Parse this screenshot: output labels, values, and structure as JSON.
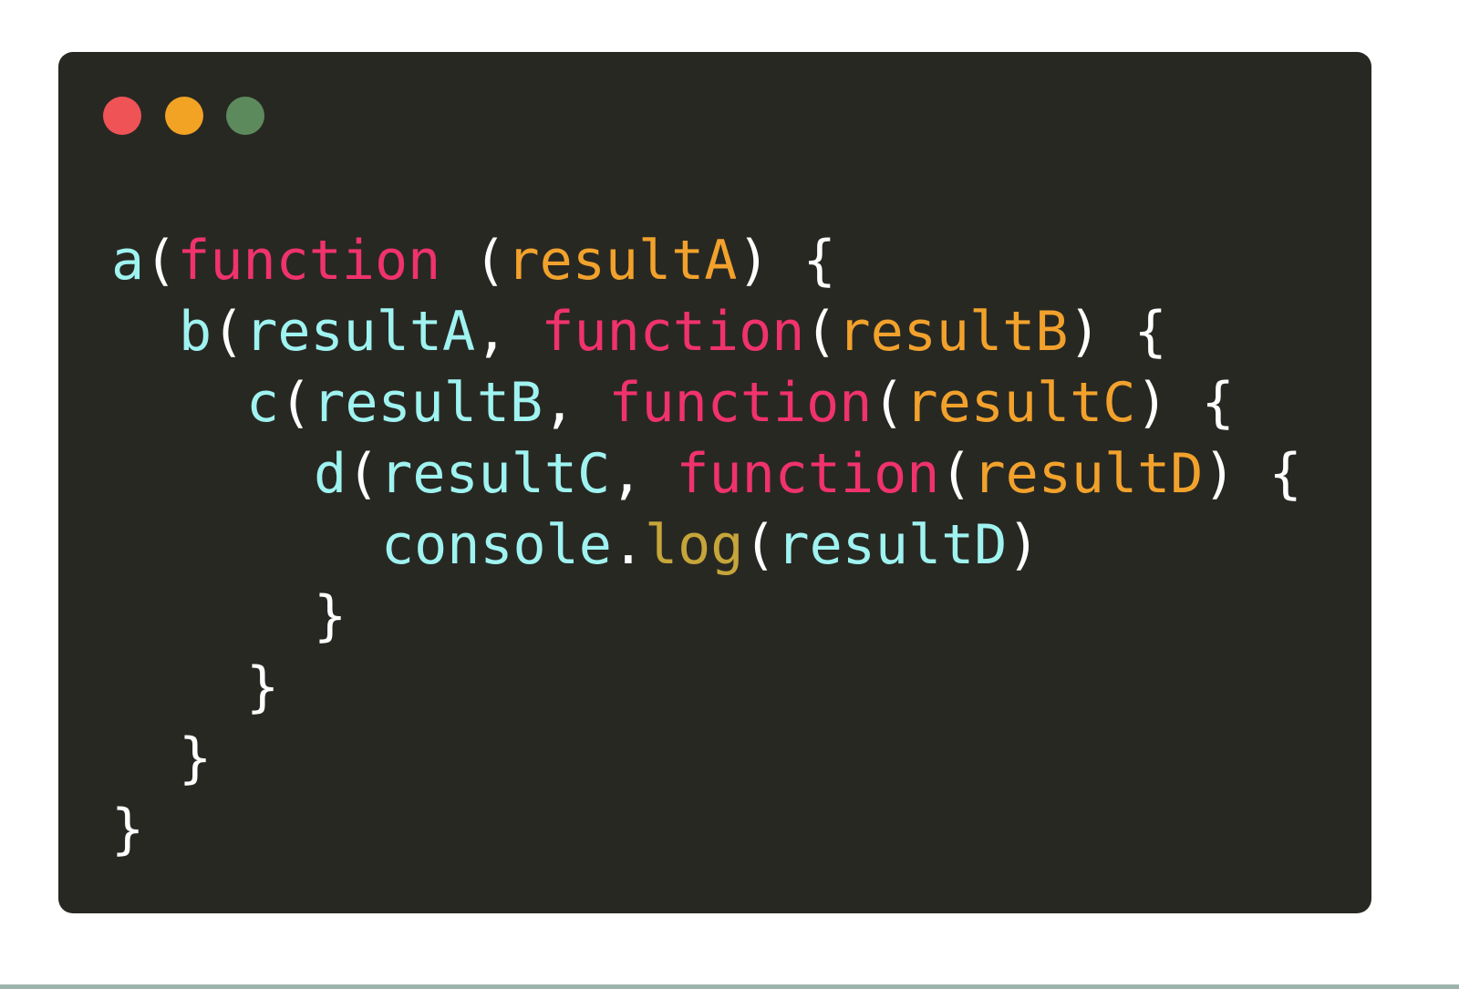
{
  "colors": {
    "background": "#282823",
    "identifier": "#9ff3f0",
    "keyword": "#f0326e",
    "parameter": "#f2a22c",
    "method": "#c6a53a",
    "punctuation": "#ffffff",
    "dot_red": "#ef5356",
    "dot_yellow": "#f2a324",
    "dot_green": "#5d8a5d"
  },
  "window": {
    "dots": [
      {
        "name": "close",
        "color": "#ef5356"
      },
      {
        "name": "minimize",
        "color": "#f2a324"
      },
      {
        "name": "maximize",
        "color": "#5d8a5d"
      }
    ]
  },
  "code": {
    "lines": [
      {
        "indent": 0,
        "tokens": [
          {
            "t": "a",
            "k": "identifier"
          },
          {
            "t": "(",
            "k": "punctuation"
          },
          {
            "t": "function",
            "k": "keyword"
          },
          {
            "t": " (",
            "k": "punctuation"
          },
          {
            "t": "resultA",
            "k": "parameter"
          },
          {
            "t": ") {",
            "k": "punctuation"
          }
        ]
      },
      {
        "indent": 1,
        "tokens": [
          {
            "t": "b",
            "k": "identifier"
          },
          {
            "t": "(",
            "k": "punctuation"
          },
          {
            "t": "resultA",
            "k": "identifier"
          },
          {
            "t": ", ",
            "k": "punctuation"
          },
          {
            "t": "function",
            "k": "keyword"
          },
          {
            "t": "(",
            "k": "punctuation"
          },
          {
            "t": "resultB",
            "k": "parameter"
          },
          {
            "t": ") {",
            "k": "punctuation"
          }
        ]
      },
      {
        "indent": 2,
        "tokens": [
          {
            "t": "c",
            "k": "identifier"
          },
          {
            "t": "(",
            "k": "punctuation"
          },
          {
            "t": "resultB",
            "k": "identifier"
          },
          {
            "t": ", ",
            "k": "punctuation"
          },
          {
            "t": "function",
            "k": "keyword"
          },
          {
            "t": "(",
            "k": "punctuation"
          },
          {
            "t": "resultC",
            "k": "parameter"
          },
          {
            "t": ") {",
            "k": "punctuation"
          }
        ]
      },
      {
        "indent": 3,
        "tokens": [
          {
            "t": "d",
            "k": "identifier"
          },
          {
            "t": "(",
            "k": "punctuation"
          },
          {
            "t": "resultC",
            "k": "identifier"
          },
          {
            "t": ", ",
            "k": "punctuation"
          },
          {
            "t": "function",
            "k": "keyword"
          },
          {
            "t": "(",
            "k": "punctuation"
          },
          {
            "t": "resultD",
            "k": "parameter"
          },
          {
            "t": ") {",
            "k": "punctuation"
          }
        ]
      },
      {
        "indent": 4,
        "tokens": [
          {
            "t": "console",
            "k": "identifier"
          },
          {
            "t": ".",
            "k": "punctuation"
          },
          {
            "t": "log",
            "k": "method"
          },
          {
            "t": "(",
            "k": "punctuation"
          },
          {
            "t": "resultD",
            "k": "identifier"
          },
          {
            "t": ")",
            "k": "punctuation"
          }
        ]
      },
      {
        "indent": 3,
        "tokens": [
          {
            "t": "}",
            "k": "punctuation"
          }
        ]
      },
      {
        "indent": 2,
        "tokens": [
          {
            "t": "}",
            "k": "punctuation"
          }
        ]
      },
      {
        "indent": 1,
        "tokens": [
          {
            "t": "}",
            "k": "punctuation"
          }
        ]
      },
      {
        "indent": 0,
        "tokens": [
          {
            "t": "}",
            "k": "punctuation"
          }
        ]
      }
    ]
  }
}
